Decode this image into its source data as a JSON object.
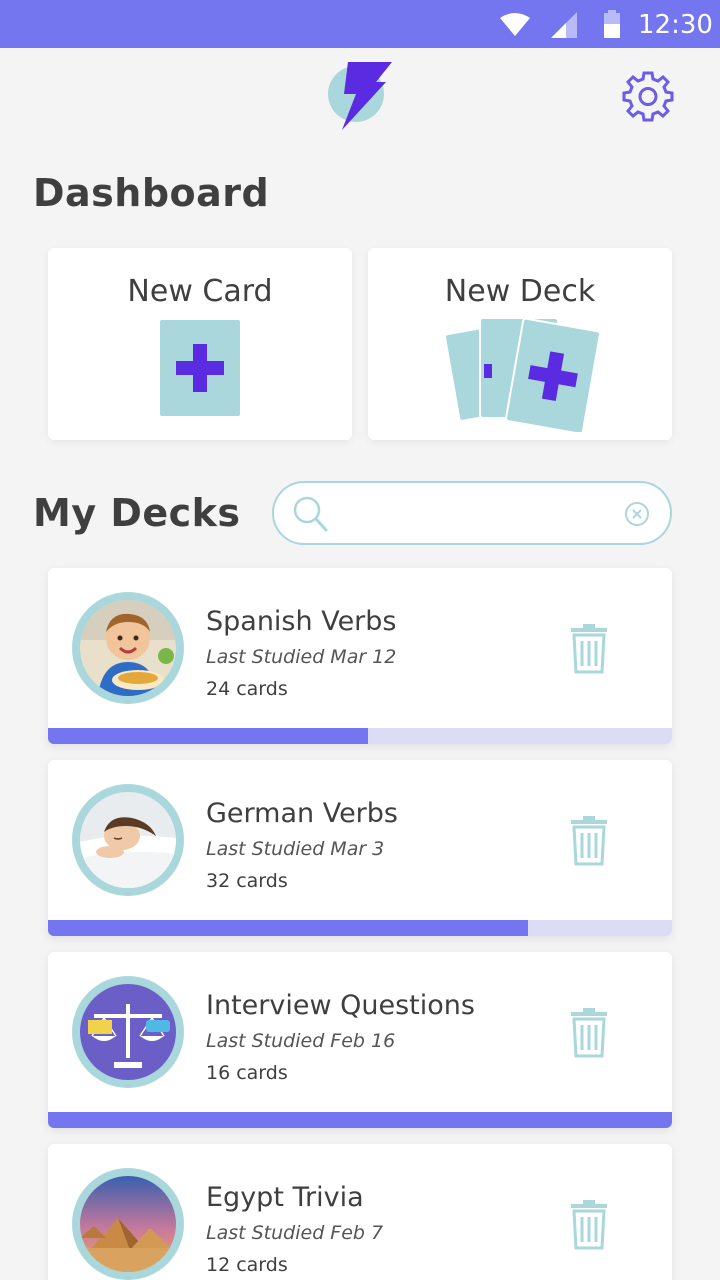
{
  "status_bar": {
    "time": "12:30"
  },
  "colors": {
    "accent": "#7376ef",
    "teal": "#a9d7dc",
    "brand_purple": "#5a2be0",
    "track": "#dcdcf8"
  },
  "dashboard": {
    "title": "Dashboard",
    "new_card_label": "New Card",
    "new_deck_label": "New Deck"
  },
  "my_decks": {
    "title": "My Decks",
    "search": {
      "value": "",
      "placeholder": ""
    }
  },
  "decks": [
    {
      "title": "Spanish Verbs",
      "last_studied": "Last Studied Mar 12",
      "count": "24 cards",
      "progress": 0.513,
      "image": "boy-eating"
    },
    {
      "title": "German Verbs",
      "last_studied": "Last Studied Mar 3",
      "count": "32 cards",
      "progress": 0.769,
      "image": "woman-sleeping"
    },
    {
      "title": "Interview Questions",
      "last_studied": "Last Studied Feb 16",
      "count": "16 cards",
      "progress": 1.0,
      "image": "balance-scale"
    },
    {
      "title": "Egypt Trivia",
      "last_studied": "Last Studied Feb 7",
      "count": "12 cards",
      "progress": null,
      "image": "pyramids"
    }
  ],
  "icons": [
    "wifi-icon",
    "signal-icon",
    "battery-icon",
    "logo-bolt-icon",
    "settings-gear-icon",
    "plus-card-icon",
    "plus-deck-icon",
    "search-icon",
    "clear-icon",
    "trash-icon"
  ]
}
